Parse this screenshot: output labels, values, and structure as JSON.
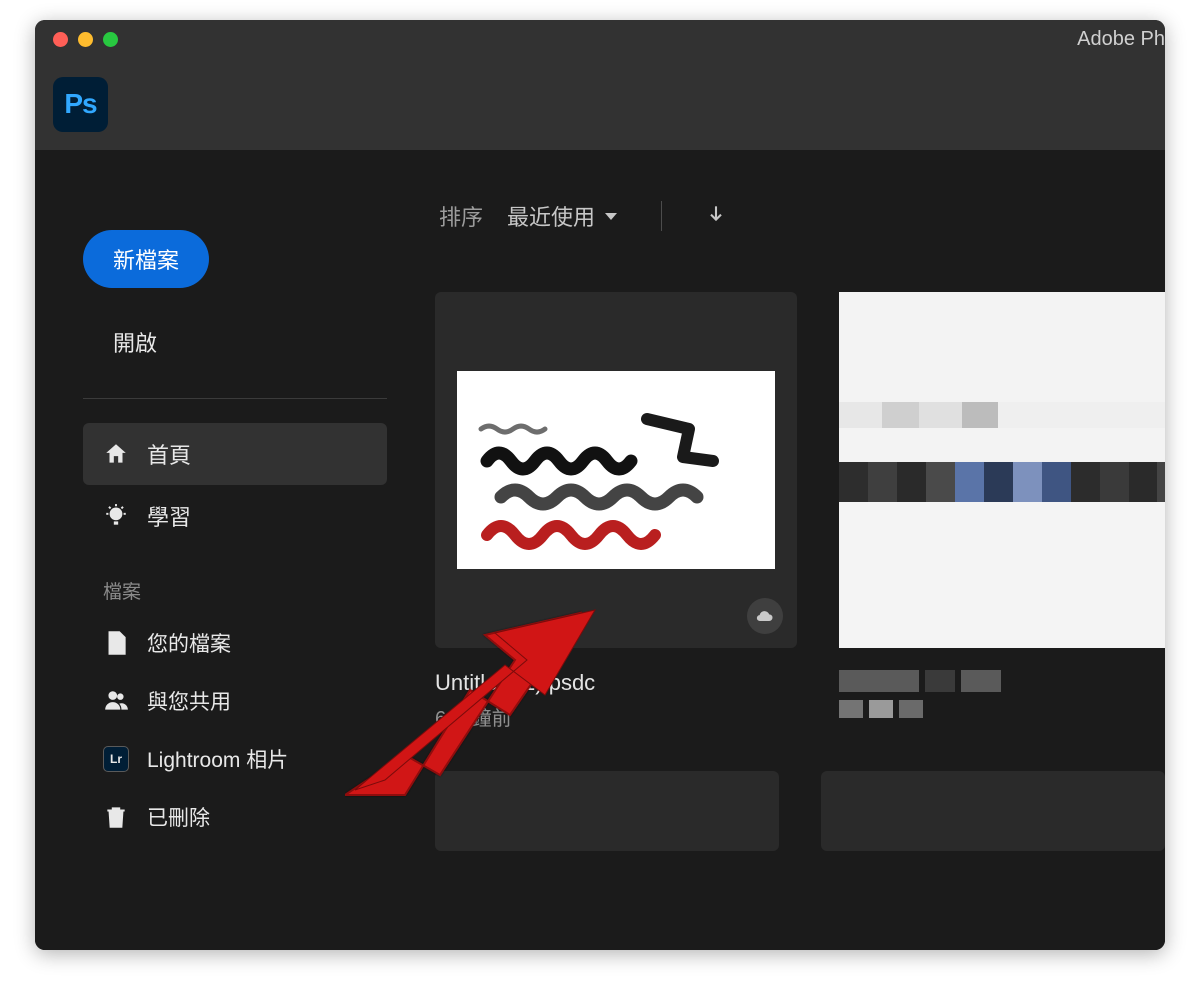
{
  "window_title": "Adobe Ph",
  "logo_text": "Ps",
  "sidebar": {
    "new_file": "新檔案",
    "open": "開啟",
    "nav": {
      "home": "首頁",
      "learn": "學習"
    },
    "files_label": "檔案",
    "file_nav": {
      "your_files": "您的檔案",
      "shared": "與您共用",
      "lightroom": "Lightroom 相片",
      "deleted": "已刪除"
    }
  },
  "sort": {
    "label": "排序",
    "mode": "最近使用"
  },
  "files": [
    {
      "name": "Untitled (1).psdc",
      "time": "6 分鐘前"
    }
  ]
}
